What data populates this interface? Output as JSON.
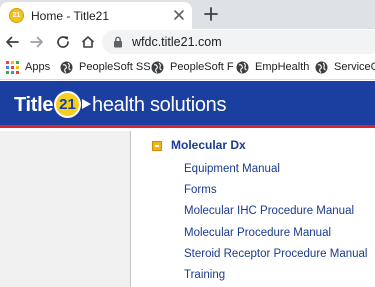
{
  "browser": {
    "tab": {
      "favicon_text": "21",
      "title": "Home - Title21"
    },
    "address": {
      "url": "wfdc.title21.com"
    },
    "bookmarks": [
      {
        "label": "Apps",
        "icon": "apps-grid-icon"
      },
      {
        "label": "PeopleSoft SS",
        "icon": "globe-icon"
      },
      {
        "label": "PeopleSoft F",
        "icon": "globe-icon"
      },
      {
        "label": "EmpHealth",
        "icon": "globe-icon"
      },
      {
        "label": "ServiceCa",
        "icon": "globe-icon"
      }
    ]
  },
  "site": {
    "logo": {
      "title": "Title",
      "badge": "21",
      "tagline": "health solutions"
    },
    "colors": {
      "header": "#1b3fa0",
      "header_rule": "#d8262f",
      "badge": "#f4cf1f",
      "link": "#1a3b8f",
      "folder_toggle": "#f2b21b"
    }
  },
  "tree": {
    "section_title": "Molecular Dx",
    "items": [
      "Equipment Manual",
      "Forms",
      "Molecular IHC Procedure Manual",
      "Molecular Procedure Manual",
      "Steroid Receptor Procedure Manual",
      "Training"
    ]
  }
}
